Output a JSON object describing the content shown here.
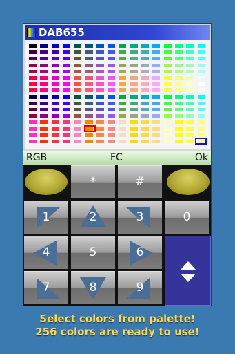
{
  "title": "DAB655",
  "app_icon": "rainbow-palette-icon",
  "infobar": {
    "left": "RGB",
    "center": "FC",
    "right": "Ok"
  },
  "palette": {
    "color_count": 256,
    "selected_color_marker": "#e00000",
    "cursor_marker": "#1010e0"
  },
  "keys": {
    "star": "*",
    "hash": "#",
    "k1": "1",
    "k2": "2",
    "k3": "3",
    "k0": "0",
    "k4": "4",
    "k5": "5",
    "k6": "6",
    "k7": "7",
    "k8": "8",
    "k9": "9"
  },
  "soft_keys": {
    "left": "left-soft-key",
    "right": "right-soft-key"
  },
  "scroll_key_icon": "up-down-arrows-icon",
  "caption": {
    "line1": "Select colors from palette!",
    "line2": "256 colors are ready to use!"
  },
  "colors": {
    "background": "#3a7ab0",
    "titlebar": "#2f46d4",
    "caption": "#ffd84a",
    "soft_key": "#b0a832",
    "scroll_key": "#34349a"
  }
}
